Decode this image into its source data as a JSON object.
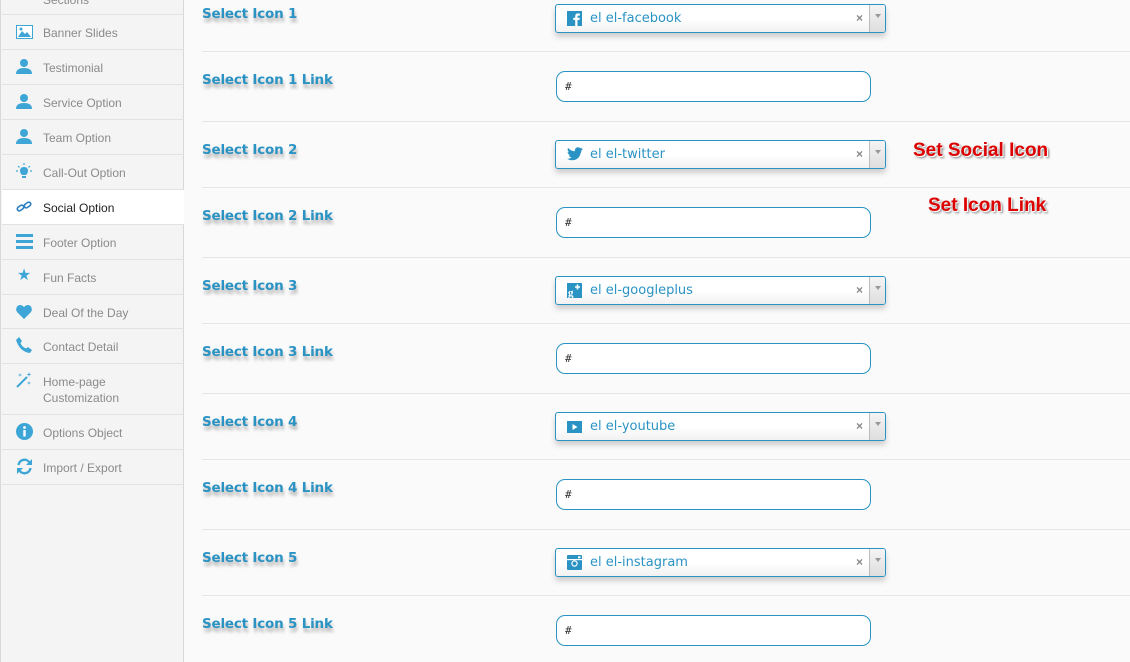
{
  "sidebar": {
    "items": [
      {
        "label": "Sections",
        "icon": "sections-icon"
      },
      {
        "label": "Banner Slides",
        "icon": "image-icon"
      },
      {
        "label": "Testimonial",
        "icon": "user-icon"
      },
      {
        "label": "Service Option",
        "icon": "user-icon"
      },
      {
        "label": "Team Option",
        "icon": "user-icon"
      },
      {
        "label": "Call-Out Option",
        "icon": "lightbulb-icon"
      },
      {
        "label": "Social Option",
        "icon": "link-icon",
        "active": true
      },
      {
        "label": "Footer Option",
        "icon": "list-icon"
      },
      {
        "label": "Fun Facts",
        "icon": "star-icon"
      },
      {
        "label": "Deal Of the Day",
        "icon": "heart-icon"
      },
      {
        "label": "Contact Detail",
        "icon": "phone-icon"
      },
      {
        "label": "Home-page Customization",
        "icon": "magic-wand-icon"
      },
      {
        "label": "Options Object",
        "icon": "info-icon"
      },
      {
        "label": "Import / Export",
        "icon": "refresh-icon"
      }
    ]
  },
  "fields": [
    {
      "label": "Select Icon 1",
      "type": "select",
      "value": "el el-facebook",
      "icon": "facebook-icon"
    },
    {
      "label": "Select Icon 1 Link",
      "type": "text",
      "value": "#"
    },
    {
      "label": "Select Icon 2",
      "type": "select",
      "value": "el el-twitter",
      "icon": "twitter-icon"
    },
    {
      "label": "Select Icon 2 Link",
      "type": "text",
      "value": "#"
    },
    {
      "label": "Select Icon 3",
      "type": "select",
      "value": "el el-googleplus",
      "icon": "googleplus-icon"
    },
    {
      "label": "Select Icon 3 Link",
      "type": "text",
      "value": "#"
    },
    {
      "label": "Select Icon 4",
      "type": "select",
      "value": "el el-youtube",
      "icon": "youtube-icon"
    },
    {
      "label": "Select Icon 4 Link",
      "type": "text",
      "value": "#"
    },
    {
      "label": "Select Icon 5",
      "type": "select",
      "value": "el el-instagram",
      "icon": "instagram-icon"
    },
    {
      "label": "Select Icon 5 Link",
      "type": "text",
      "value": "#"
    }
  ],
  "select_clear_glyph": "×",
  "annotations": {
    "social_icon": "Set Social Icon",
    "icon_link": "Set Icon Link"
  },
  "colors": {
    "accent": "#2a93c4",
    "icon_blue": "#3ea6d6",
    "annotation_red": "#dd0000"
  }
}
